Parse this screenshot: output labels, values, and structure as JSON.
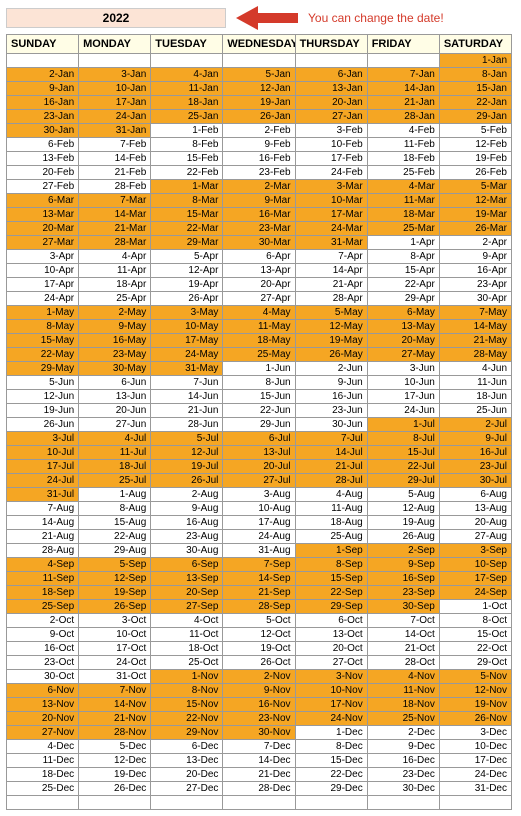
{
  "year": "2022",
  "hint_text": "You can change the date!",
  "headers": [
    "SUNDAY",
    "MONDAY",
    "TUESDAY",
    "WEDNESDAY",
    "THURSDAY",
    "FRIDAY",
    "SATURDAY"
  ],
  "rows": [
    {
      "cells": [
        "",
        "",
        "",
        "",
        "",
        "",
        "1-Jan"
      ],
      "hl": [
        0,
        0,
        0,
        0,
        0,
        0,
        1
      ]
    },
    {
      "cells": [
        "2-Jan",
        "3-Jan",
        "4-Jan",
        "5-Jan",
        "6-Jan",
        "7-Jan",
        "8-Jan"
      ],
      "hl": [
        1,
        1,
        1,
        1,
        1,
        1,
        1
      ]
    },
    {
      "cells": [
        "9-Jan",
        "10-Jan",
        "11-Jan",
        "12-Jan",
        "13-Jan",
        "14-Jan",
        "15-Jan"
      ],
      "hl": [
        1,
        1,
        1,
        1,
        1,
        1,
        1
      ]
    },
    {
      "cells": [
        "16-Jan",
        "17-Jan",
        "18-Jan",
        "19-Jan",
        "20-Jan",
        "21-Jan",
        "22-Jan"
      ],
      "hl": [
        1,
        1,
        1,
        1,
        1,
        1,
        1
      ]
    },
    {
      "cells": [
        "23-Jan",
        "24-Jan",
        "25-Jan",
        "26-Jan",
        "27-Jan",
        "28-Jan",
        "29-Jan"
      ],
      "hl": [
        1,
        1,
        1,
        1,
        1,
        1,
        1
      ]
    },
    {
      "cells": [
        "30-Jan",
        "31-Jan",
        "1-Feb",
        "2-Feb",
        "3-Feb",
        "4-Feb",
        "5-Feb"
      ],
      "hl": [
        1,
        1,
        0,
        0,
        0,
        0,
        0
      ]
    },
    {
      "cells": [
        "6-Feb",
        "7-Feb",
        "8-Feb",
        "9-Feb",
        "10-Feb",
        "11-Feb",
        "12-Feb"
      ],
      "hl": [
        0,
        0,
        0,
        0,
        0,
        0,
        0
      ]
    },
    {
      "cells": [
        "13-Feb",
        "14-Feb",
        "15-Feb",
        "16-Feb",
        "17-Feb",
        "18-Feb",
        "19-Feb"
      ],
      "hl": [
        0,
        0,
        0,
        0,
        0,
        0,
        0
      ]
    },
    {
      "cells": [
        "20-Feb",
        "21-Feb",
        "22-Feb",
        "23-Feb",
        "24-Feb",
        "25-Feb",
        "26-Feb"
      ],
      "hl": [
        0,
        0,
        0,
        0,
        0,
        0,
        0
      ]
    },
    {
      "cells": [
        "27-Feb",
        "28-Feb",
        "1-Mar",
        "2-Mar",
        "3-Mar",
        "4-Mar",
        "5-Mar"
      ],
      "hl": [
        0,
        0,
        1,
        1,
        1,
        1,
        1
      ]
    },
    {
      "cells": [
        "6-Mar",
        "7-Mar",
        "8-Mar",
        "9-Mar",
        "10-Mar",
        "11-Mar",
        "12-Mar"
      ],
      "hl": [
        1,
        1,
        1,
        1,
        1,
        1,
        1
      ]
    },
    {
      "cells": [
        "13-Mar",
        "14-Mar",
        "15-Mar",
        "16-Mar",
        "17-Mar",
        "18-Mar",
        "19-Mar"
      ],
      "hl": [
        1,
        1,
        1,
        1,
        1,
        1,
        1
      ]
    },
    {
      "cells": [
        "20-Mar",
        "21-Mar",
        "22-Mar",
        "23-Mar",
        "24-Mar",
        "25-Mar",
        "26-Mar"
      ],
      "hl": [
        1,
        1,
        1,
        1,
        1,
        1,
        1
      ]
    },
    {
      "cells": [
        "27-Mar",
        "28-Mar",
        "29-Mar",
        "30-Mar",
        "31-Mar",
        "1-Apr",
        "2-Apr"
      ],
      "hl": [
        1,
        1,
        1,
        1,
        1,
        0,
        0
      ]
    },
    {
      "cells": [
        "3-Apr",
        "4-Apr",
        "5-Apr",
        "6-Apr",
        "7-Apr",
        "8-Apr",
        "9-Apr"
      ],
      "hl": [
        0,
        0,
        0,
        0,
        0,
        0,
        0
      ]
    },
    {
      "cells": [
        "10-Apr",
        "11-Apr",
        "12-Apr",
        "13-Apr",
        "14-Apr",
        "15-Apr",
        "16-Apr"
      ],
      "hl": [
        0,
        0,
        0,
        0,
        0,
        0,
        0
      ]
    },
    {
      "cells": [
        "17-Apr",
        "18-Apr",
        "19-Apr",
        "20-Apr",
        "21-Apr",
        "22-Apr",
        "23-Apr"
      ],
      "hl": [
        0,
        0,
        0,
        0,
        0,
        0,
        0
      ]
    },
    {
      "cells": [
        "24-Apr",
        "25-Apr",
        "26-Apr",
        "27-Apr",
        "28-Apr",
        "29-Apr",
        "30-Apr"
      ],
      "hl": [
        0,
        0,
        0,
        0,
        0,
        0,
        0
      ]
    },
    {
      "cells": [
        "1-May",
        "2-May",
        "3-May",
        "4-May",
        "5-May",
        "6-May",
        "7-May"
      ],
      "hl": [
        1,
        1,
        1,
        1,
        1,
        1,
        1
      ]
    },
    {
      "cells": [
        "8-May",
        "9-May",
        "10-May",
        "11-May",
        "12-May",
        "13-May",
        "14-May"
      ],
      "hl": [
        1,
        1,
        1,
        1,
        1,
        1,
        1
      ]
    },
    {
      "cells": [
        "15-May",
        "16-May",
        "17-May",
        "18-May",
        "19-May",
        "20-May",
        "21-May"
      ],
      "hl": [
        1,
        1,
        1,
        1,
        1,
        1,
        1
      ]
    },
    {
      "cells": [
        "22-May",
        "23-May",
        "24-May",
        "25-May",
        "26-May",
        "27-May",
        "28-May"
      ],
      "hl": [
        1,
        1,
        1,
        1,
        1,
        1,
        1
      ]
    },
    {
      "cells": [
        "29-May",
        "30-May",
        "31-May",
        "1-Jun",
        "2-Jun",
        "3-Jun",
        "4-Jun"
      ],
      "hl": [
        1,
        1,
        1,
        0,
        0,
        0,
        0
      ]
    },
    {
      "cells": [
        "5-Jun",
        "6-Jun",
        "7-Jun",
        "8-Jun",
        "9-Jun",
        "10-Jun",
        "11-Jun"
      ],
      "hl": [
        0,
        0,
        0,
        0,
        0,
        0,
        0
      ]
    },
    {
      "cells": [
        "12-Jun",
        "13-Jun",
        "14-Jun",
        "15-Jun",
        "16-Jun",
        "17-Jun",
        "18-Jun"
      ],
      "hl": [
        0,
        0,
        0,
        0,
        0,
        0,
        0
      ]
    },
    {
      "cells": [
        "19-Jun",
        "20-Jun",
        "21-Jun",
        "22-Jun",
        "23-Jun",
        "24-Jun",
        "25-Jun"
      ],
      "hl": [
        0,
        0,
        0,
        0,
        0,
        0,
        0
      ]
    },
    {
      "cells": [
        "26-Jun",
        "27-Jun",
        "28-Jun",
        "29-Jun",
        "30-Jun",
        "1-Jul",
        "2-Jul"
      ],
      "hl": [
        0,
        0,
        0,
        0,
        0,
        1,
        1
      ]
    },
    {
      "cells": [
        "3-Jul",
        "4-Jul",
        "5-Jul",
        "6-Jul",
        "7-Jul",
        "8-Jul",
        "9-Jul"
      ],
      "hl": [
        1,
        1,
        1,
        1,
        1,
        1,
        1
      ]
    },
    {
      "cells": [
        "10-Jul",
        "11-Jul",
        "12-Jul",
        "13-Jul",
        "14-Jul",
        "15-Jul",
        "16-Jul"
      ],
      "hl": [
        1,
        1,
        1,
        1,
        1,
        1,
        1
      ]
    },
    {
      "cells": [
        "17-Jul",
        "18-Jul",
        "19-Jul",
        "20-Jul",
        "21-Jul",
        "22-Jul",
        "23-Jul"
      ],
      "hl": [
        1,
        1,
        1,
        1,
        1,
        1,
        1
      ]
    },
    {
      "cells": [
        "24-Jul",
        "25-Jul",
        "26-Jul",
        "27-Jul",
        "28-Jul",
        "29-Jul",
        "30-Jul"
      ],
      "hl": [
        1,
        1,
        1,
        1,
        1,
        1,
        1
      ]
    },
    {
      "cells": [
        "31-Jul",
        "1-Aug",
        "2-Aug",
        "3-Aug",
        "4-Aug",
        "5-Aug",
        "6-Aug"
      ],
      "hl": [
        1,
        0,
        0,
        0,
        0,
        0,
        0
      ]
    },
    {
      "cells": [
        "7-Aug",
        "8-Aug",
        "9-Aug",
        "10-Aug",
        "11-Aug",
        "12-Aug",
        "13-Aug"
      ],
      "hl": [
        0,
        0,
        0,
        0,
        0,
        0,
        0
      ]
    },
    {
      "cells": [
        "14-Aug",
        "15-Aug",
        "16-Aug",
        "17-Aug",
        "18-Aug",
        "19-Aug",
        "20-Aug"
      ],
      "hl": [
        0,
        0,
        0,
        0,
        0,
        0,
        0
      ]
    },
    {
      "cells": [
        "21-Aug",
        "22-Aug",
        "23-Aug",
        "24-Aug",
        "25-Aug",
        "26-Aug",
        "27-Aug"
      ],
      "hl": [
        0,
        0,
        0,
        0,
        0,
        0,
        0
      ]
    },
    {
      "cells": [
        "28-Aug",
        "29-Aug",
        "30-Aug",
        "31-Aug",
        "1-Sep",
        "2-Sep",
        "3-Sep"
      ],
      "hl": [
        0,
        0,
        0,
        0,
        1,
        1,
        1
      ]
    },
    {
      "cells": [
        "4-Sep",
        "5-Sep",
        "6-Sep",
        "7-Sep",
        "8-Sep",
        "9-Sep",
        "10-Sep"
      ],
      "hl": [
        1,
        1,
        1,
        1,
        1,
        1,
        1
      ]
    },
    {
      "cells": [
        "11-Sep",
        "12-Sep",
        "13-Sep",
        "14-Sep",
        "15-Sep",
        "16-Sep",
        "17-Sep"
      ],
      "hl": [
        1,
        1,
        1,
        1,
        1,
        1,
        1
      ]
    },
    {
      "cells": [
        "18-Sep",
        "19-Sep",
        "20-Sep",
        "21-Sep",
        "22-Sep",
        "23-Sep",
        "24-Sep"
      ],
      "hl": [
        1,
        1,
        1,
        1,
        1,
        1,
        1
      ]
    },
    {
      "cells": [
        "25-Sep",
        "26-Sep",
        "27-Sep",
        "28-Sep",
        "29-Sep",
        "30-Sep",
        "1-Oct"
      ],
      "hl": [
        1,
        1,
        1,
        1,
        1,
        1,
        0
      ]
    },
    {
      "cells": [
        "2-Oct",
        "3-Oct",
        "4-Oct",
        "5-Oct",
        "6-Oct",
        "7-Oct",
        "8-Oct"
      ],
      "hl": [
        0,
        0,
        0,
        0,
        0,
        0,
        0
      ]
    },
    {
      "cells": [
        "9-Oct",
        "10-Oct",
        "11-Oct",
        "12-Oct",
        "13-Oct",
        "14-Oct",
        "15-Oct"
      ],
      "hl": [
        0,
        0,
        0,
        0,
        0,
        0,
        0
      ]
    },
    {
      "cells": [
        "16-Oct",
        "17-Oct",
        "18-Oct",
        "19-Oct",
        "20-Oct",
        "21-Oct",
        "22-Oct"
      ],
      "hl": [
        0,
        0,
        0,
        0,
        0,
        0,
        0
      ]
    },
    {
      "cells": [
        "23-Oct",
        "24-Oct",
        "25-Oct",
        "26-Oct",
        "27-Oct",
        "28-Oct",
        "29-Oct"
      ],
      "hl": [
        0,
        0,
        0,
        0,
        0,
        0,
        0
      ]
    },
    {
      "cells": [
        "30-Oct",
        "31-Oct",
        "1-Nov",
        "2-Nov",
        "3-Nov",
        "4-Nov",
        "5-Nov"
      ],
      "hl": [
        0,
        0,
        1,
        1,
        1,
        1,
        1
      ]
    },
    {
      "cells": [
        "6-Nov",
        "7-Nov",
        "8-Nov",
        "9-Nov",
        "10-Nov",
        "11-Nov",
        "12-Nov"
      ],
      "hl": [
        1,
        1,
        1,
        1,
        1,
        1,
        1
      ]
    },
    {
      "cells": [
        "13-Nov",
        "14-Nov",
        "15-Nov",
        "16-Nov",
        "17-Nov",
        "18-Nov",
        "19-Nov"
      ],
      "hl": [
        1,
        1,
        1,
        1,
        1,
        1,
        1
      ]
    },
    {
      "cells": [
        "20-Nov",
        "21-Nov",
        "22-Nov",
        "23-Nov",
        "24-Nov",
        "25-Nov",
        "26-Nov"
      ],
      "hl": [
        1,
        1,
        1,
        1,
        1,
        1,
        1
      ]
    },
    {
      "cells": [
        "27-Nov",
        "28-Nov",
        "29-Nov",
        "30-Nov",
        "1-Dec",
        "2-Dec",
        "3-Dec"
      ],
      "hl": [
        1,
        1,
        1,
        1,
        0,
        0,
        0
      ]
    },
    {
      "cells": [
        "4-Dec",
        "5-Dec",
        "6-Dec",
        "7-Dec",
        "8-Dec",
        "9-Dec",
        "10-Dec"
      ],
      "hl": [
        0,
        0,
        0,
        0,
        0,
        0,
        0
      ]
    },
    {
      "cells": [
        "11-Dec",
        "12-Dec",
        "13-Dec",
        "14-Dec",
        "15-Dec",
        "16-Dec",
        "17-Dec"
      ],
      "hl": [
        0,
        0,
        0,
        0,
        0,
        0,
        0
      ]
    },
    {
      "cells": [
        "18-Dec",
        "19-Dec",
        "20-Dec",
        "21-Dec",
        "22-Dec",
        "23-Dec",
        "24-Dec"
      ],
      "hl": [
        0,
        0,
        0,
        0,
        0,
        0,
        0
      ]
    },
    {
      "cells": [
        "25-Dec",
        "26-Dec",
        "27-Dec",
        "28-Dec",
        "29-Dec",
        "30-Dec",
        "31-Dec"
      ],
      "hl": [
        0,
        0,
        0,
        0,
        0,
        0,
        0
      ]
    },
    {
      "cells": [
        "",
        "",
        "",
        "",
        "",
        "",
        ""
      ],
      "hl": [
        0,
        0,
        0,
        0,
        0,
        0,
        0
      ]
    }
  ]
}
